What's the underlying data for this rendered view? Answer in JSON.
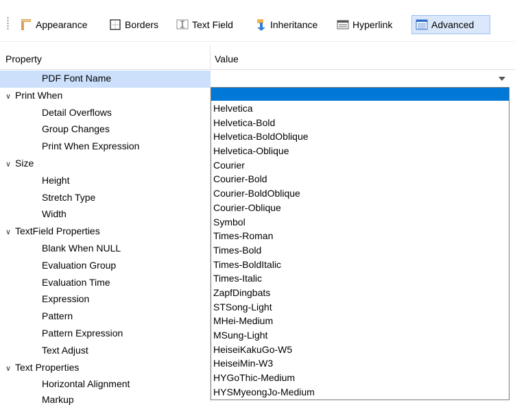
{
  "toolbar": {
    "tabs": [
      {
        "label": "Appearance",
        "icon": "appearance-icon"
      },
      {
        "label": "Borders",
        "icon": "borders-icon"
      },
      {
        "label": "Text Field",
        "icon": "text-field-icon"
      },
      {
        "label": "Inheritance",
        "icon": "inheritance-icon"
      },
      {
        "label": "Hyperlink",
        "icon": "hyperlink-icon"
      },
      {
        "label": "Advanced",
        "icon": "advanced-icon",
        "selected": true
      }
    ]
  },
  "table": {
    "header_property": "Property",
    "header_value": "Value",
    "rows": [
      {
        "label": "PDF Font Name",
        "kind": "sub",
        "selected": true
      },
      {
        "label": "Print When",
        "kind": "category"
      },
      {
        "label": "Detail Overflows",
        "kind": "sub"
      },
      {
        "label": "Group Changes",
        "kind": "sub"
      },
      {
        "label": "Print When Expression",
        "kind": "sub"
      },
      {
        "label": "Size",
        "kind": "category"
      },
      {
        "label": "Height",
        "kind": "sub"
      },
      {
        "label": "Stretch Type",
        "kind": "sub"
      },
      {
        "label": "Width",
        "kind": "sub"
      },
      {
        "label": "TextField Properties",
        "kind": "category"
      },
      {
        "label": "Blank When NULL",
        "kind": "sub"
      },
      {
        "label": "Evaluation Group",
        "kind": "sub"
      },
      {
        "label": "Evaluation Time",
        "kind": "sub"
      },
      {
        "label": "Expression",
        "kind": "sub"
      },
      {
        "label": "Pattern",
        "kind": "sub"
      },
      {
        "label": "Pattern Expression",
        "kind": "sub"
      },
      {
        "label": "Text Adjust",
        "kind": "sub"
      },
      {
        "label": "Text Properties",
        "kind": "category"
      },
      {
        "label": "Horizontal Alignment",
        "kind": "sub"
      }
    ],
    "peek_row": "Markup"
  },
  "dropdown": {
    "options": [
      "Helvetica",
      "Helvetica-Bold",
      "Helvetica-BoldOblique",
      "Helvetica-Oblique",
      "Courier",
      "Courier-Bold",
      "Courier-BoldOblique",
      "Courier-Oblique",
      "Symbol",
      "Times-Roman",
      "Times-Bold",
      "Times-BoldItalic",
      "Times-Italic",
      "ZapfDingbats",
      "STSong-Light",
      "MHei-Medium",
      "MSung-Light",
      "HeiseiKakuGo-W5",
      "HeiseiMin-W3",
      "HYGoThic-Medium",
      "HYSMyeongJo-Medium"
    ]
  },
  "colors": {
    "selection_blue": "#0078d7",
    "row_selected": "#cce0fb",
    "tab_selected": "#dbe8fb"
  }
}
